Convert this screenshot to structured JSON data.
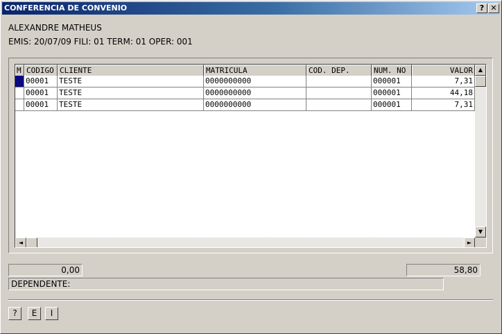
{
  "window": {
    "title": "CONFERENCIA DE CONVENIO",
    "help_label": "?",
    "close_label": "✕"
  },
  "header": {
    "name": "ALEXANDRE MATHEUS",
    "info": "EMIS: 20/07/09 FILI: 01 TERM: 01 OPER: 001"
  },
  "table": {
    "columns": [
      "M",
      "CODIGO",
      "CLIENTE",
      "MATRICULA",
      "COD. DEP.",
      "NUM. NO",
      "VALOR"
    ],
    "rows": [
      {
        "codigo": "00001",
        "cliente": "TESTE",
        "matricula": "0000000000",
        "cod_dep": "",
        "num_no": "000001",
        "valor": "7,31"
      },
      {
        "codigo": "00001",
        "cliente": "TESTE",
        "matricula": "0000000000",
        "cod_dep": "",
        "num_no": "000001",
        "valor": "44,18"
      },
      {
        "codigo": "00001",
        "cliente": "TESTE",
        "matricula": "0000000000",
        "cod_dep": "",
        "num_no": "000001",
        "valor": "7,31"
      }
    ]
  },
  "footer": {
    "left_total": "0,00",
    "right_total": "58,80",
    "dependente_label": "DEPENDENTE:"
  },
  "buttons": {
    "help": "?",
    "e": "E",
    "i": "I"
  },
  "icons": {
    "up": "▲",
    "down": "▼",
    "left": "◄",
    "right": "►"
  }
}
